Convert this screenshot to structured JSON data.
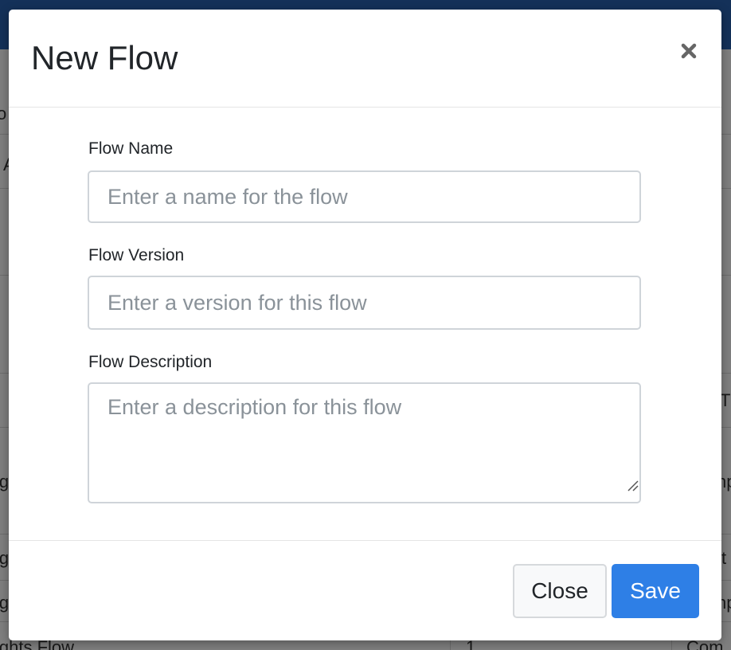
{
  "background": {
    "row_texts": [
      {
        "text": "o"
      },
      {
        "text": "A"
      },
      {
        "text": "T"
      },
      {
        "text": "ig"
      },
      {
        "text": "np"
      },
      {
        "text": "ig"
      },
      {
        "text": "t"
      },
      {
        "text": "ig"
      },
      {
        "text": "np"
      },
      {
        "text": "ights Flow"
      },
      {
        "text": "1"
      },
      {
        "text": "Com"
      }
    ]
  },
  "modal": {
    "title": "New Flow",
    "close_icon": "close-icon",
    "fields": {
      "name": {
        "label": "Flow Name",
        "placeholder": "Enter a name for the flow",
        "value": ""
      },
      "version": {
        "label": "Flow Version",
        "placeholder": "Enter a version for this flow",
        "value": ""
      },
      "description": {
        "label": "Flow Description",
        "placeholder": "Enter a description for this flow",
        "value": ""
      }
    },
    "footer": {
      "close_label": "Close",
      "save_label": "Save"
    },
    "colors": {
      "primary": "#2e7fe6",
      "topbar": "#2962b3"
    }
  }
}
